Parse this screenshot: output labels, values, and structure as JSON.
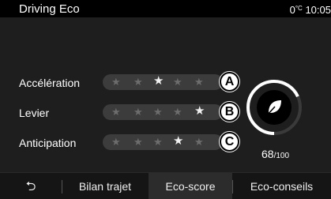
{
  "header": {
    "title": "Driving Eco",
    "temperature_value": "0",
    "temperature_unit": "°C",
    "time": "10:05"
  },
  "criteria": [
    {
      "label": "Accélération",
      "stars_total": 5,
      "stars_lit": [
        3
      ],
      "marker": "A"
    },
    {
      "label": "Levier",
      "stars_total": 5,
      "stars_lit": [
        5
      ],
      "marker": "B"
    },
    {
      "label": "Anticipation",
      "stars_total": 5,
      "stars_lit": [
        4
      ],
      "marker": "C"
    }
  ],
  "score": {
    "value": "68",
    "max": "/100",
    "fraction": 0.68,
    "icon": "leaf-icon"
  },
  "tabs": [
    {
      "label": "Bilan trajet",
      "active": false
    },
    {
      "label": "Eco-score",
      "active": true
    },
    {
      "label": "Eco-conseils",
      "active": false
    }
  ],
  "back_icon": "back-arrow-icon",
  "colors": {
    "background": "#000000",
    "panel": "#1e1e1e",
    "pill": "#3c3c3c",
    "star_off": "#6d6d6d",
    "star_on": "#f2f2f2",
    "active_tab": "#2c2c2c"
  }
}
